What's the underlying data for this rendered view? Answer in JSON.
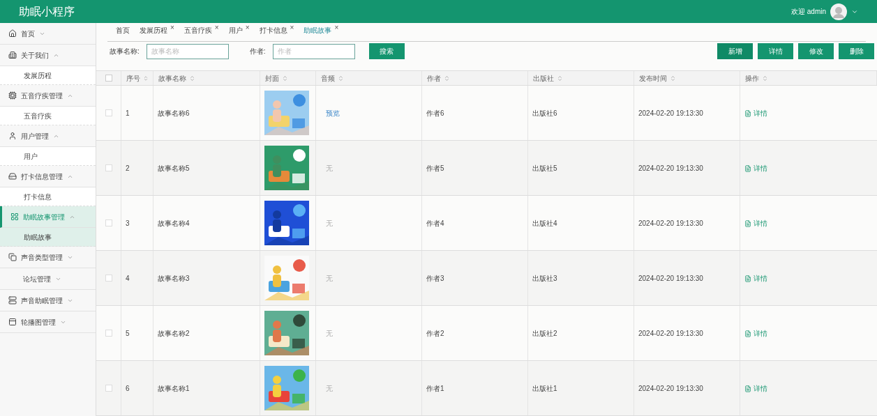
{
  "header": {
    "title": "助眠小程序",
    "greeting": "欢迎 admin"
  },
  "sidebar": {
    "items": [
      {
        "label": "首页",
        "expanded": false,
        "selected": false
      },
      {
        "label": "关于我们",
        "expanded": true,
        "selected": false,
        "children": [
          {
            "label": "发展历程",
            "selected": false
          }
        ]
      },
      {
        "label": "五音疗疾管理",
        "expanded": true,
        "selected": false,
        "children": [
          {
            "label": "五音疗疾",
            "selected": false
          }
        ]
      },
      {
        "label": "用户管理",
        "expanded": true,
        "selected": false,
        "children": [
          {
            "label": "用户",
            "selected": false
          }
        ]
      },
      {
        "label": "打卡信息管理",
        "expanded": true,
        "selected": false,
        "children": [
          {
            "label": "打卡信息",
            "selected": false
          }
        ]
      },
      {
        "label": "助眠故事管理",
        "expanded": true,
        "selected": true,
        "children": [
          {
            "label": "助眠故事",
            "selected": true
          }
        ]
      },
      {
        "label": "声音类型管理",
        "expanded": false,
        "selected": false
      },
      {
        "label": "论坛管理",
        "expanded": false,
        "selected": false
      },
      {
        "label": "声音助眠管理",
        "expanded": false,
        "selected": false
      },
      {
        "label": "轮播图管理",
        "expanded": false,
        "selected": false
      }
    ]
  },
  "tabs": [
    {
      "label": "首页",
      "selected": false,
      "closable": false
    },
    {
      "label": "发展历程",
      "selected": false,
      "closable": true
    },
    {
      "label": "五音疗疾",
      "selected": false,
      "closable": true
    },
    {
      "label": "用户",
      "selected": false,
      "closable": true
    },
    {
      "label": "打卡信息",
      "selected": false,
      "closable": true
    },
    {
      "label": "助眠故事",
      "selected": true,
      "closable": true
    }
  ],
  "tab_close": "×",
  "search": {
    "fields": [
      {
        "label": "故事名称:",
        "placeholder": "故事名称"
      },
      {
        "label": "作者:",
        "placeholder": "作者"
      }
    ],
    "button": "搜索"
  },
  "actions": [
    "新增",
    "详情",
    "修改",
    "删除"
  ],
  "table": {
    "select_all_checked": false,
    "columns": [
      "序号",
      "故事名称",
      "封面",
      "音频",
      "作者",
      "出版社",
      "发布时间",
      "操作"
    ],
    "rows": [
      {
        "checked": false,
        "index": "1",
        "name": "故事名称6",
        "audio": {
          "kind": "link",
          "text": "预览"
        },
        "author": "作者6",
        "publisher": "出版社6",
        "time": "2024-02-20 19:13:30",
        "action": "详情"
      },
      {
        "checked": false,
        "index": "2",
        "name": "故事名称5",
        "audio": {
          "kind": "none",
          "text": "无"
        },
        "author": "作者5",
        "publisher": "出版社5",
        "time": "2024-02-20 19:13:30",
        "action": "详情"
      },
      {
        "checked": false,
        "index": "3",
        "name": "故事名称4",
        "audio": {
          "kind": "none",
          "text": "无"
        },
        "author": "作者4",
        "publisher": "出版社4",
        "time": "2024-02-20 19:13:30",
        "action": "详情"
      },
      {
        "checked": false,
        "index": "4",
        "name": "故事名称3",
        "audio": {
          "kind": "none",
          "text": "无"
        },
        "author": "作者3",
        "publisher": "出版社3",
        "time": "2024-02-20 19:13:30",
        "action": "详情"
      },
      {
        "checked": false,
        "index": "5",
        "name": "故事名称2",
        "audio": {
          "kind": "none",
          "text": "无"
        },
        "author": "作者2",
        "publisher": "出版社2",
        "time": "2024-02-20 19:13:30",
        "action": "详情"
      },
      {
        "checked": false,
        "index": "6",
        "name": "故事名称1",
        "audio": {
          "kind": "none",
          "text": "无"
        },
        "author": "作者1",
        "publisher": "出版社1",
        "time": "2024-02-20 19:13:30",
        "action": "详情"
      }
    ]
  }
}
